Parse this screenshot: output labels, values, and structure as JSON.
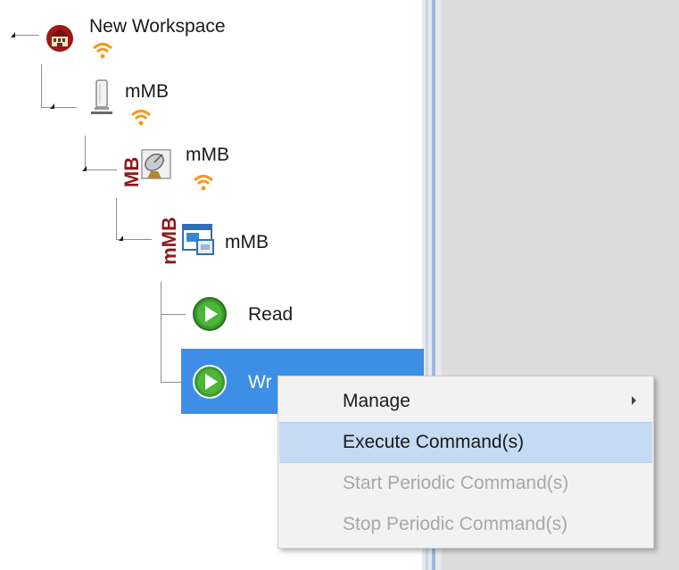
{
  "tree": {
    "workspace": {
      "label": "New Workspace"
    },
    "device": {
      "label": "mMB"
    },
    "channel": {
      "label": "mMB",
      "badge": "MB"
    },
    "unit": {
      "label": "mMB",
      "badge": "mMB"
    },
    "commands": [
      {
        "label": "Read"
      },
      {
        "label": "Wr"
      }
    ]
  },
  "context_menu": {
    "items": [
      {
        "label": "Manage",
        "state": "normal",
        "has_submenu": true
      },
      {
        "label": "Execute Command(s)",
        "state": "hover",
        "has_submenu": false
      },
      {
        "label": "Start Periodic Command(s)",
        "state": "disabled",
        "has_submenu": false
      },
      {
        "label": "Stop Periodic Command(s)",
        "state": "disabled",
        "has_submenu": false
      }
    ]
  },
  "colors": {
    "selection": "#3d8fe6",
    "menu_hover": "#c5daf3",
    "wifi": "#f39a1e",
    "play_green": "#3a9a2a",
    "badge_red": "#8b1a1a"
  },
  "icons": [
    "workspace-icon",
    "wifi-icon",
    "device-icon",
    "satellite-dish-icon",
    "window-icon",
    "play-icon",
    "submenu-arrow-icon"
  ]
}
